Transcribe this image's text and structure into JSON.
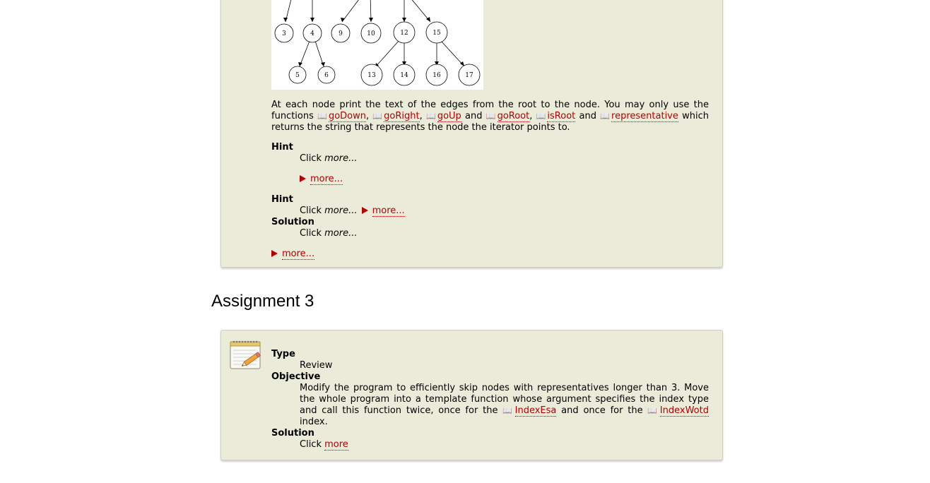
{
  "assignment2": {
    "tree_nodes": [
      "3",
      "4",
      "9",
      "10",
      "12",
      "15",
      "5",
      "6",
      "13",
      "14",
      "16",
      "17"
    ],
    "paragraph": {
      "text1": "At each node print the text of the edges from the root to the node. You may only use the functions ",
      "link_goDown": "goDown",
      "sep1": ", ",
      "link_goRight": "goRight",
      "sep2": ", ",
      "link_goUp": "goUp",
      "and1": " and ",
      "link_goRoot": "goRoot",
      "sep3": ", ",
      "link_isRoot": "isRoot",
      "and2": " and ",
      "link_representative": "representative",
      "text2": " which returns the string that represents the node the iterator points to."
    },
    "hint1_label": "Hint",
    "hint1_click": "Click ",
    "hint1_more_em": "more...",
    "hint1_toggle": "more...",
    "hint2_label": "Hint",
    "hint2_click": "Click ",
    "hint2_more_em": "more...",
    "hint2_toggle": "more...",
    "solution_label": "Solution",
    "solution_click": "Click ",
    "solution_more_em": "more...",
    "solution_toggle": "more..."
  },
  "assignment3": {
    "heading": "Assignment 3",
    "type_label": "Type",
    "type_value": "Review",
    "objective_label": "Objective",
    "objective_text1": "Modify the program to efficiently skip nodes with representatives longer than 3. Move the whole program into a template function whose argument specifies the index type and call this function twice, once for the ",
    "link_IndexEsa": "IndexEsa",
    "objective_text2": " and once for the ",
    "link_IndexWotd": "IndexWotd",
    "objective_text3": " index.",
    "solution_label": "Solution",
    "solution_click": "Click ",
    "solution_link": "more"
  },
  "icons": {
    "book_icon_glyph": "📖",
    "notepad_icon": "notepad-pencil-icon"
  },
  "colors": {
    "panel_bg": "#ebebda",
    "link": "#b50000"
  }
}
